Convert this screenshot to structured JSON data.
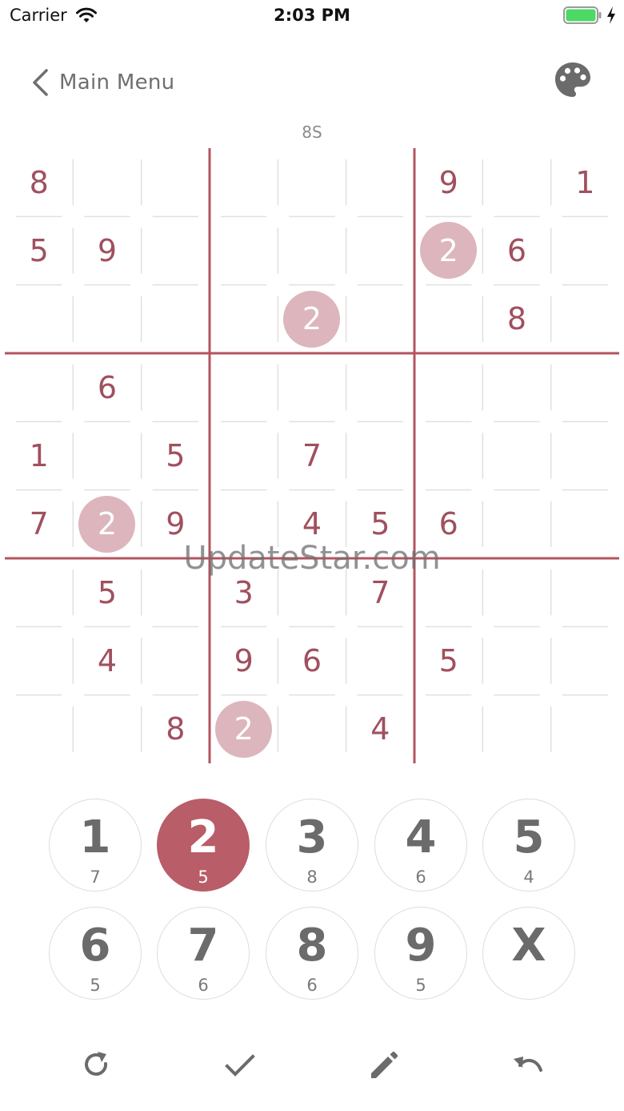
{
  "status_bar": {
    "carrier": "Carrier",
    "time": "2:03 PM"
  },
  "nav": {
    "back_label": "Main Menu",
    "level_label": "8S"
  },
  "board": {
    "grid": [
      [
        "8",
        "",
        "",
        "",
        "",
        "",
        "9",
        "",
        "1"
      ],
      [
        "5",
        "9",
        "",
        "",
        "",
        "",
        "2",
        "6",
        ""
      ],
      [
        "",
        "",
        "",
        "",
        "2",
        "",
        "",
        "8",
        ""
      ],
      [
        "",
        "6",
        "",
        "",
        "",
        "",
        "",
        "",
        ""
      ],
      [
        "1",
        "",
        "5",
        "",
        "7",
        "",
        "",
        "",
        ""
      ],
      [
        "7",
        "2",
        "9",
        "",
        "4",
        "5",
        "6",
        "",
        ""
      ],
      [
        "",
        "5",
        "",
        "3",
        "",
        "7",
        "",
        "",
        ""
      ],
      [
        "",
        "4",
        "",
        "9",
        "6",
        "",
        "5",
        "",
        ""
      ],
      [
        "",
        "",
        "8",
        "2",
        "",
        "4",
        "",
        "",
        ""
      ]
    ],
    "highlighted_digit": "2"
  },
  "keypad": {
    "keys": [
      {
        "label": "1",
        "count": "7"
      },
      {
        "label": "2",
        "count": "5"
      },
      {
        "label": "3",
        "count": "8"
      },
      {
        "label": "4",
        "count": "6"
      },
      {
        "label": "5",
        "count": "4"
      },
      {
        "label": "6",
        "count": "5"
      },
      {
        "label": "7",
        "count": "6"
      },
      {
        "label": "8",
        "count": "6"
      },
      {
        "label": "9",
        "count": "5"
      },
      {
        "label": "X",
        "count": ""
      }
    ],
    "selected": "2"
  },
  "toolbar": {
    "icons": [
      "restart-icon",
      "check-icon",
      "pencil-icon",
      "undo-icon"
    ]
  },
  "watermark": "UpdateStar.com",
  "colors": {
    "accent": "#b95d68",
    "given_digit": "#a0505e",
    "highlight": "#dcb6bc",
    "grid_major": "#b3555f",
    "grid_minor": "#e0e0e0",
    "icon": "#6b6b6b",
    "battery": "#4cd964"
  }
}
